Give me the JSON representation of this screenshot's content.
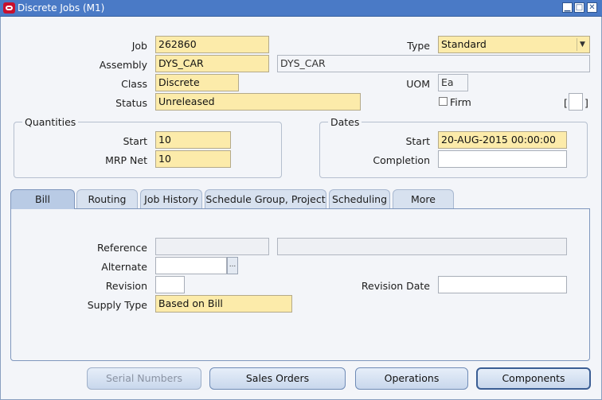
{
  "window": {
    "title": "Discrete Jobs (M1)",
    "minimize": "▁",
    "maximize": "□",
    "close": "✕"
  },
  "header": {
    "job_label": "Job",
    "job_value": "262860",
    "type_label": "Type",
    "type_value": "Standard",
    "assembly_label": "Assembly",
    "assembly_value": "DYS_CAR",
    "assembly_desc": "DYS_CAR",
    "class_label": "Class",
    "class_value": "Discrete",
    "uom_label": "UOM",
    "uom_value": "Ea",
    "status_label": "Status",
    "status_value": "Unreleased",
    "firm_label": "Firm",
    "flex_open": "[",
    "flex_close": "]"
  },
  "quantities": {
    "title": "Quantities",
    "start_label": "Start",
    "start_value": "10",
    "mrp_net_label": "MRP Net",
    "mrp_net_value": "10"
  },
  "dates": {
    "title": "Dates",
    "start_label": "Start",
    "start_value": "20-AUG-2015 00:00:00",
    "completion_label": "Completion",
    "completion_value": ""
  },
  "tabs": [
    {
      "label": "Bill",
      "active": true
    },
    {
      "label": "Routing"
    },
    {
      "label": "Job History"
    },
    {
      "label": "Schedule Group, Project"
    },
    {
      "label": "Scheduling"
    },
    {
      "label": "More"
    }
  ],
  "bill": {
    "reference_label": "Reference",
    "reference_value": "",
    "reference_desc": "",
    "alternate_label": "Alternate",
    "alternate_value": "",
    "lov": "...",
    "revision_label": "Revision",
    "revision_value": "",
    "revision_date_label": "Revision Date",
    "revision_date_value": "",
    "supply_type_label": "Supply Type",
    "supply_type_value": "Based on Bill"
  },
  "buttons": {
    "serial_numbers": "Serial Numbers",
    "sales_orders": "Sales Orders",
    "operations": "Operations",
    "components": "Components"
  },
  "colors": {
    "required_field": "#fcebaa",
    "title_bar": "#4a7ac6",
    "close_brand": "#c8102e"
  }
}
